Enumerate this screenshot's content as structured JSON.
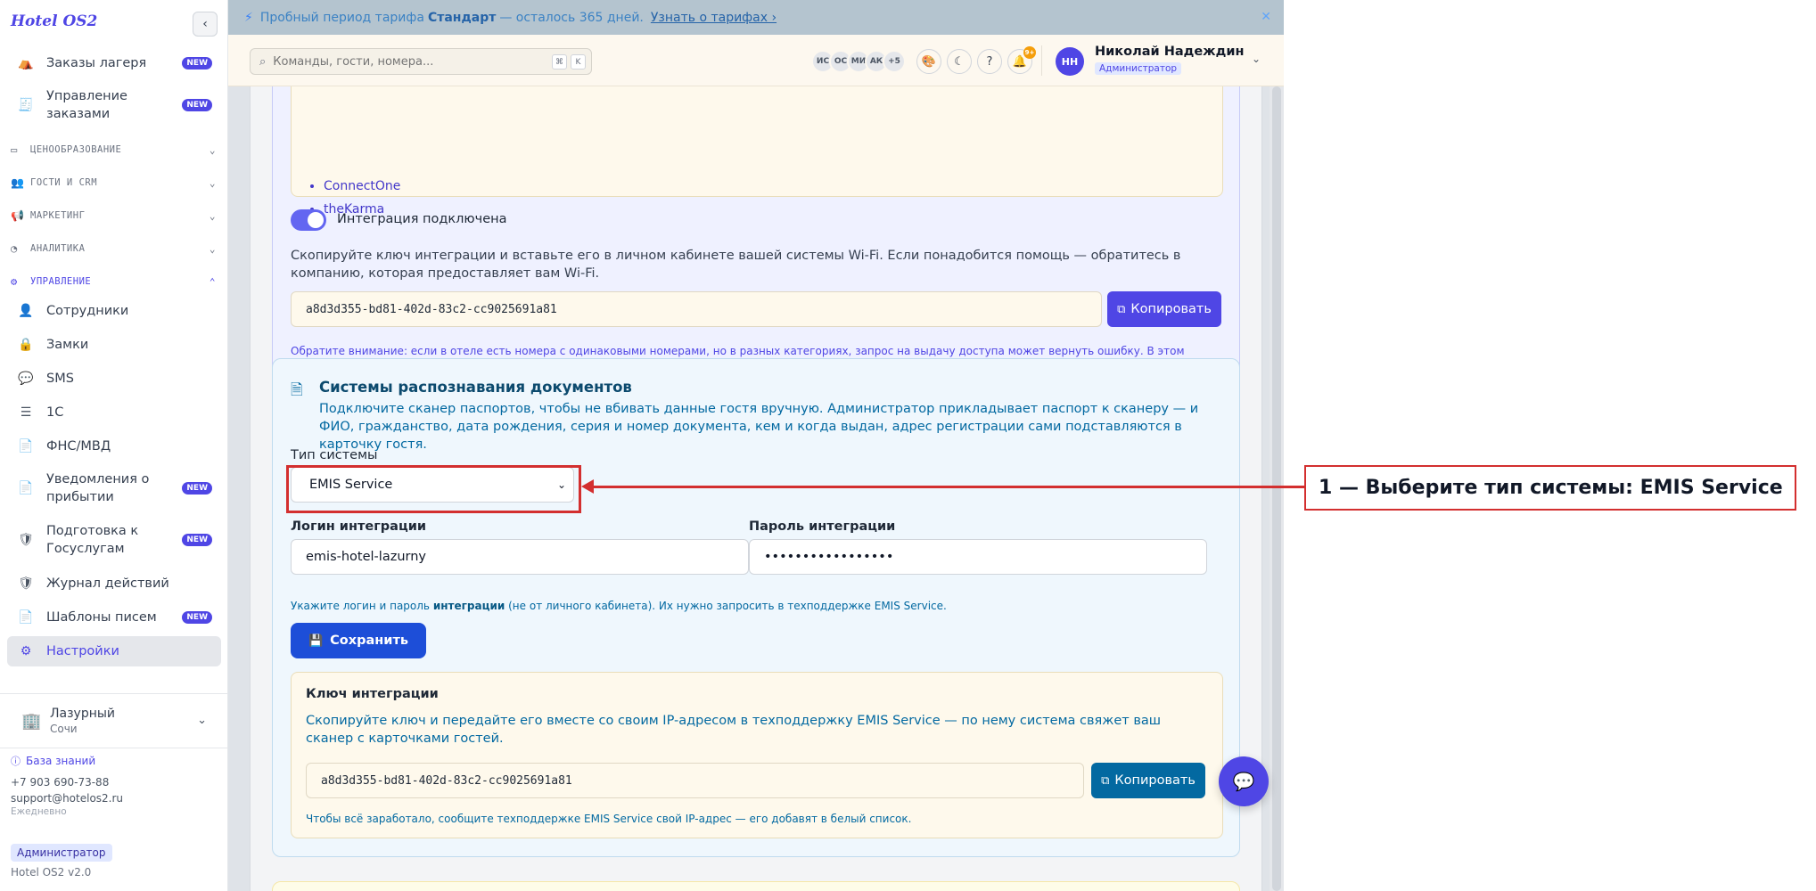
{
  "sidebar": {
    "brand": "Hotel OS2",
    "items_top": [
      {
        "label": "Заказы лагеря",
        "badge": "NEW"
      },
      {
        "label": "Управление заказами",
        "badge": "NEW"
      }
    ],
    "sections": [
      {
        "label": "ЦЕНООБРАЗОВАНИЕ"
      },
      {
        "label": "ГОСТИ И CRM"
      },
      {
        "label": "МАРКЕТИНГ"
      },
      {
        "label": "АНАЛИТИКА"
      },
      {
        "label": "УПРАВЛЕНИЕ"
      }
    ],
    "items_manage": [
      {
        "label": "Сотрудники"
      },
      {
        "label": "Замки"
      },
      {
        "label": "SMS"
      },
      {
        "label": "1С"
      },
      {
        "label": "ФНС/МВД"
      },
      {
        "label": "Уведомления о прибытии",
        "badge": "NEW"
      },
      {
        "label": "Подготовка к Госуслугам",
        "badge": "NEW"
      },
      {
        "label": "Журнал действий"
      },
      {
        "label": "Шаблоны писем",
        "badge": "NEW"
      },
      {
        "label": "Настройки"
      }
    ],
    "hotel": {
      "name": "Лазурный",
      "city": "Сочи"
    },
    "support": {
      "kb_label": "База знаний",
      "phone": "+7 903 690-73-88",
      "email": "support@hotelos2.ru",
      "schedule": "Ежедневно"
    },
    "role_badge": "Администратор",
    "version": "Hotel OS2 v2.0"
  },
  "banner": {
    "prefix": "Пробный период тарифа",
    "plan": "Стандарт",
    "suffix": "— осталось 365 дней.",
    "link": "Узнать о тарифах ›"
  },
  "header": {
    "search_placeholder": "Команды, гости, номера...",
    "kbd_1": "⌘",
    "kbd_2": "K",
    "avatars": [
      "ИС",
      "ОС",
      "МИ",
      "АК",
      "+5"
    ],
    "notif_count": "9+",
    "user_initials": "НН",
    "user_name": "Николай Надеждин",
    "user_role": "Администратор"
  },
  "wifi": {
    "list": [
      "ConnectOne",
      "theKarma"
    ],
    "toggle_label": "Интеграция подключена",
    "desc": "Скопируйте ключ интеграции и вставьте его в личном кабинете вашей системы Wi-Fi. Если понадобится помощь — обратитесь в компанию, которая предоставляет вам Wi-Fi.",
    "key": "a8d3d355-bd81-402d-83c2-cc9025691a81",
    "copy_label": "Копировать",
    "note": "Обратите внимание: если в отеле есть номера с одинаковыми номерами, но в разных категориях, запрос на выдачу доступа может вернуть ошибку. В этом случае переименуйте один из номеров, чтобы его номер был уникальным."
  },
  "docs": {
    "title": "Системы распознавания документов",
    "desc": "Подключите сканер паспортов, чтобы не вбивать данные гостя вручную. Администратор прикладывает паспорт к сканеру — и ФИО, гражданство, дата рождения, серия и номер документа, кем и когда выдан, адрес регистрации сами подставляются в карточку гостя.",
    "system_type_label": "Тип системы",
    "system_type_value": "EMIS Service",
    "login_label": "Логин интеграции",
    "login_value": "emis-hotel-lazurny",
    "password_label": "Пароль интеграции",
    "password_value": "•••••••••••••••••",
    "hint_pre": "Укажите логин и пароль",
    "hint_bold": "интеграции",
    "hint_post": "(не от личного кабинета). Их нужно запросить в техподдержке EMIS Service.",
    "save_label": "Сохранить",
    "int_key_title": "Ключ интеграции",
    "int_key_desc": "Скопируйте ключ и передайте его вместе со своим IP-адресом в техподдержку EMIS Service — по нему система свяжет ваш сканер с карточками гостей.",
    "int_key_value": "a8d3d355-bd81-402d-83c2-cc9025691a81",
    "int_copy_label": "Копировать",
    "int_key_note": "Чтобы всё заработало, сообщите техподдержке EMIS Service свой IP-адрес — его добавят в белый список."
  },
  "annotation": {
    "callout": "1 — Выберите тип системы: EMIS Service"
  },
  "colors": {
    "accent": "#4f46e5",
    "annotation": "#d32f2f"
  }
}
